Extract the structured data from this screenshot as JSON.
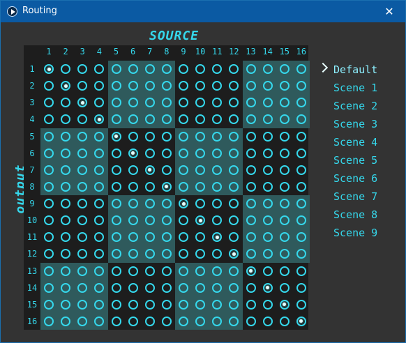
{
  "window": {
    "title": "Routing",
    "close_glyph": "✕"
  },
  "headings": {
    "source": "SOURCE",
    "output": "output"
  },
  "matrix": {
    "columns": [
      "1",
      "2",
      "3",
      "4",
      "5",
      "6",
      "7",
      "8",
      "9",
      "10",
      "11",
      "12",
      "13",
      "14",
      "15",
      "16"
    ],
    "rows": [
      "1",
      "2",
      "3",
      "4",
      "5",
      "6",
      "7",
      "8",
      "9",
      "10",
      "11",
      "12",
      "13",
      "14",
      "15",
      "16"
    ],
    "selected_source_per_output": [
      1,
      2,
      3,
      4,
      5,
      6,
      7,
      8,
      9,
      10,
      11,
      12,
      13,
      14,
      15,
      16
    ]
  },
  "scenes": {
    "active": "Default",
    "items": [
      "Default",
      "Scene 1",
      "Scene 2",
      "Scene 3",
      "Scene 4",
      "Scene 5",
      "Scene 6",
      "Scene 7",
      "Scene 8",
      "Scene 9"
    ]
  },
  "colors": {
    "accent": "#35d8ec",
    "panel": "#333333",
    "band": "#2f5a5c",
    "titlebar": "#0b5aa3"
  }
}
